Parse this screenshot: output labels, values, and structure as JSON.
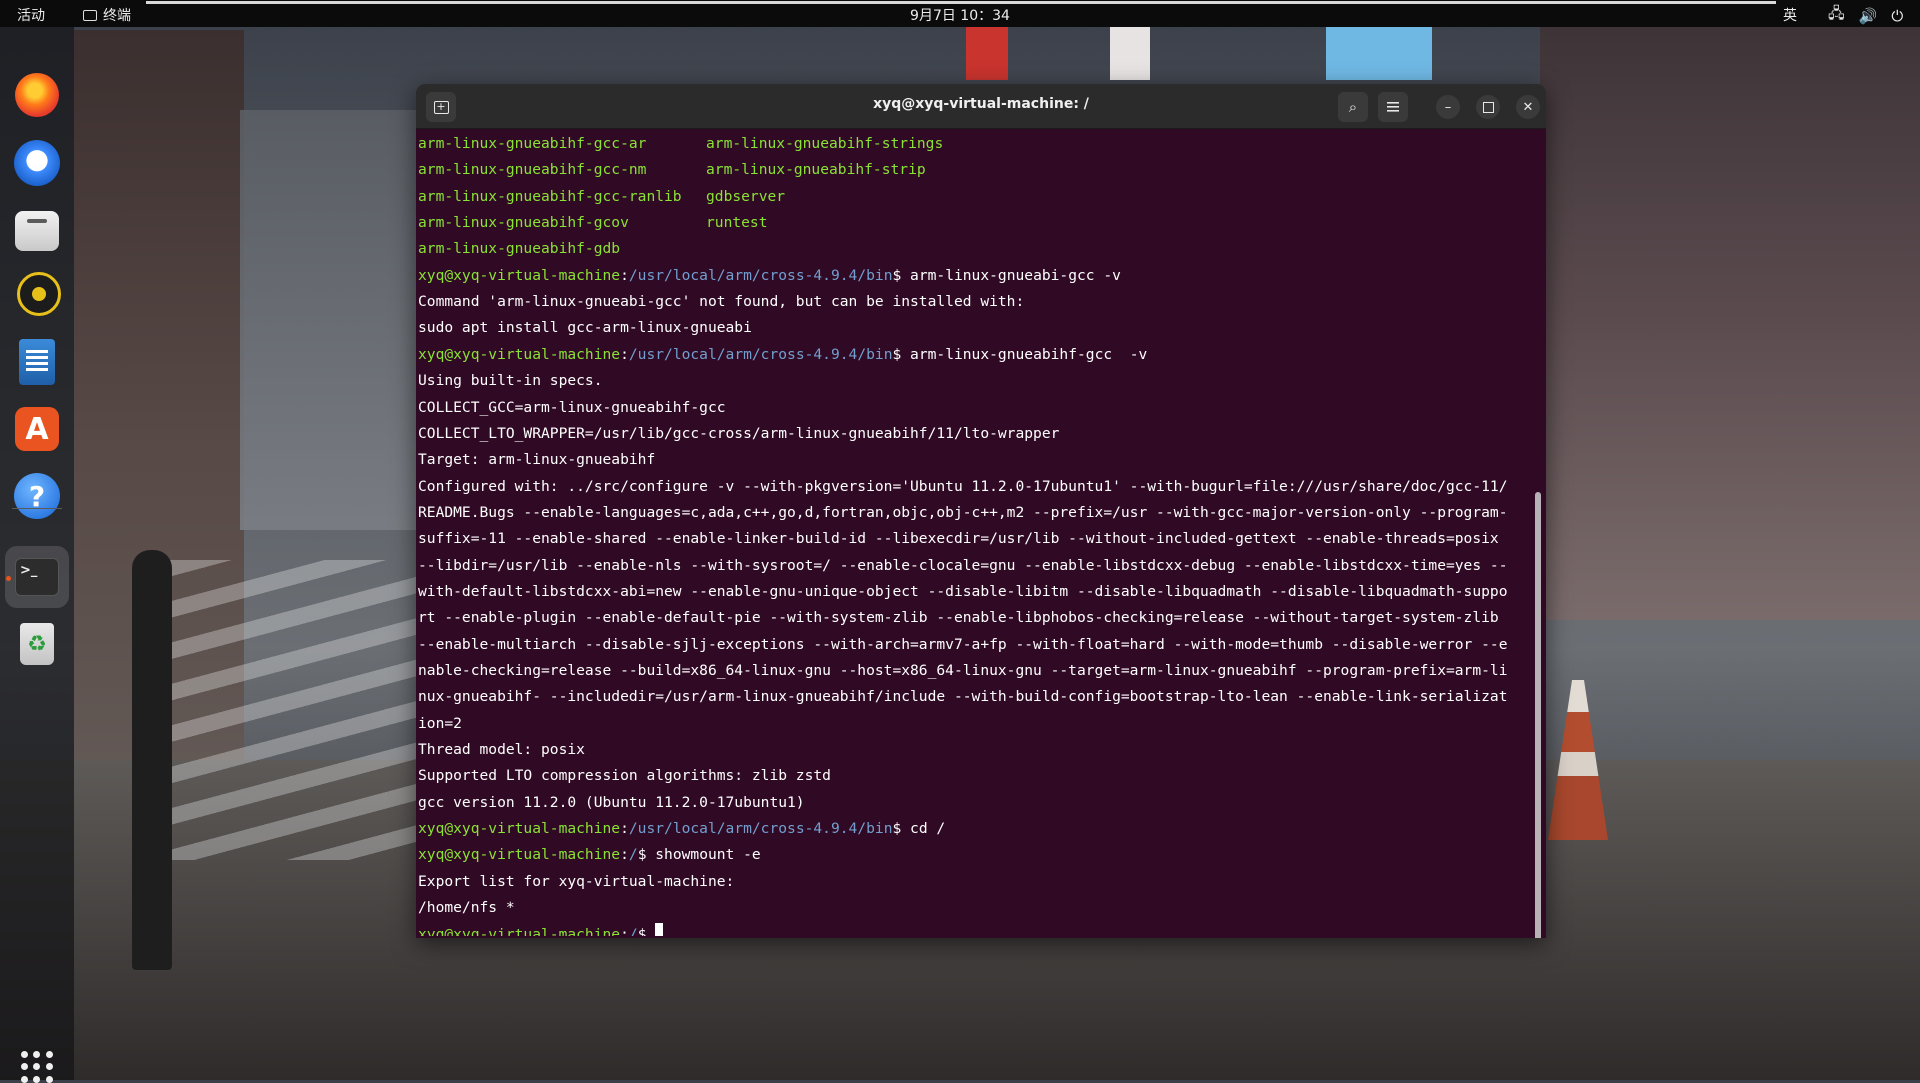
{
  "topbar": {
    "activities": "活动",
    "app_name": "终端",
    "clock": "9月7日  10：34",
    "input_method": "英"
  },
  "dock": {
    "items": [
      {
        "name": "firefox",
        "icon": "firefox-icon"
      },
      {
        "name": "thunderbird",
        "icon": "mail-icon"
      },
      {
        "name": "files",
        "icon": "folder-icon"
      },
      {
        "name": "rhythmbox",
        "icon": "music-icon"
      },
      {
        "name": "libreoffice-writer",
        "icon": "document-icon"
      },
      {
        "name": "app-center",
        "icon": "store-icon",
        "glyph": "A"
      },
      {
        "name": "help",
        "icon": "help-icon",
        "glyph": "?"
      },
      {
        "name": "terminal",
        "icon": "terminal-icon",
        "glyph": ">_"
      },
      {
        "name": "trash",
        "icon": "recycle-icon",
        "glyph": "♻"
      }
    ],
    "show_apps_icon": "grid-icon"
  },
  "window": {
    "title": "xyq@xyq-virtual-machine: /"
  },
  "terminal": {
    "colors": {
      "background": "#300a24",
      "user": "#8ae234",
      "path": "#729fcf",
      "text": "#ffffff"
    },
    "lines": [
      {
        "type": "cols",
        "left": "arm-linux-gnueabihf-gcc-ar",
        "right": "arm-linux-gnueabihf-strings"
      },
      {
        "type": "cols",
        "left": "arm-linux-gnueabihf-gcc-nm",
        "right": "arm-linux-gnueabihf-strip"
      },
      {
        "type": "cols",
        "left": "arm-linux-gnueabihf-gcc-ranlib",
        "right": "gdbserver"
      },
      {
        "type": "cols",
        "left": "arm-linux-gnueabihf-gcov",
        "right": "runtest"
      },
      {
        "type": "cols",
        "left": "arm-linux-gnueabihf-gdb",
        "right": ""
      },
      {
        "type": "prompt",
        "user": "xyq@xyq-virtual-machine",
        "path": "/usr/local/arm/cross-4.9.4/bin",
        "cmd": "$ arm-linux-gnueabi-gcc -v"
      },
      {
        "type": "text",
        "text": "Command 'arm-linux-gnueabi-gcc' not found, but can be installed with:"
      },
      {
        "type": "text",
        "text": "sudo apt install gcc-arm-linux-gnueabi"
      },
      {
        "type": "prompt",
        "user": "xyq@xyq-virtual-machine",
        "path": "/usr/local/arm/cross-4.9.4/bin",
        "cmd": "$ arm-linux-gnueabihf-gcc  -v"
      },
      {
        "type": "text",
        "text": "Using built-in specs."
      },
      {
        "type": "text",
        "text": "COLLECT_GCC=arm-linux-gnueabihf-gcc"
      },
      {
        "type": "text",
        "text": "COLLECT_LTO_WRAPPER=/usr/lib/gcc-cross/arm-linux-gnueabihf/11/lto-wrapper"
      },
      {
        "type": "text",
        "text": "Target: arm-linux-gnueabihf"
      },
      {
        "type": "text",
        "text": "Configured with: ../src/configure -v --with-pkgversion='Ubuntu 11.2.0-17ubuntu1' --with-bugurl=file:///usr/share/doc/gcc-11/"
      },
      {
        "type": "text",
        "text": "README.Bugs --enable-languages=c,ada,c++,go,d,fortran,objc,obj-c++,m2 --prefix=/usr --with-gcc-major-version-only --program-"
      },
      {
        "type": "text",
        "text": "suffix=-11 --enable-shared --enable-linker-build-id --libexecdir=/usr/lib --without-included-gettext --enable-threads=posix"
      },
      {
        "type": "text",
        "text": "--libdir=/usr/lib --enable-nls --with-sysroot=/ --enable-clocale=gnu --enable-libstdcxx-debug --enable-libstdcxx-time=yes --"
      },
      {
        "type": "text",
        "text": "with-default-libstdcxx-abi=new --enable-gnu-unique-object --disable-libitm --disable-libquadmath --disable-libquadmath-suppo"
      },
      {
        "type": "text",
        "text": "rt --enable-plugin --enable-default-pie --with-system-zlib --enable-libphobos-checking=release --without-target-system-zlib"
      },
      {
        "type": "text",
        "text": "--enable-multiarch --disable-sjlj-exceptions --with-arch=armv7-a+fp --with-float=hard --with-mode=thumb --disable-werror --e"
      },
      {
        "type": "text",
        "text": "nable-checking=release --build=x86_64-linux-gnu --host=x86_64-linux-gnu --target=arm-linux-gnueabihf --program-prefix=arm-li"
      },
      {
        "type": "text",
        "text": "nux-gnueabihf- --includedir=/usr/arm-linux-gnueabihf/include --with-build-config=bootstrap-lto-lean --enable-link-serializat"
      },
      {
        "type": "text",
        "text": "ion=2"
      },
      {
        "type": "text",
        "text": "Thread model: posix"
      },
      {
        "type": "text",
        "text": "Supported LTO compression algorithms: zlib zstd"
      },
      {
        "type": "text",
        "text": "gcc version 11.2.0 (Ubuntu 11.2.0-17ubuntu1)"
      },
      {
        "type": "prompt",
        "user": "xyq@xyq-virtual-machine",
        "path": "/usr/local/arm/cross-4.9.4/bin",
        "cmd": "$ cd /"
      },
      {
        "type": "prompt",
        "user": "xyq@xyq-virtual-machine",
        "path": "/",
        "cmd": "$ showmount -e"
      },
      {
        "type": "text",
        "text": "Export list for xyq-virtual-machine:"
      },
      {
        "type": "text",
        "text": "/home/nfs *"
      },
      {
        "type": "prompt",
        "user": "xyq@xyq-virtual-machine",
        "path": "/",
        "cmd": "$ ",
        "cursor": true
      }
    ]
  }
}
